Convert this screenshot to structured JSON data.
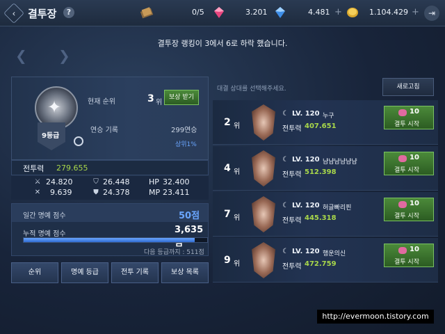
{
  "header": {
    "title": "결투장",
    "help": "?",
    "tickets": "0/5",
    "gem_red": "3.201",
    "gem_blue": "4.481",
    "gold": "1.104.429"
  },
  "notice": "결투장 랭킹이 3에서 6로 하락 했습니다.",
  "player": {
    "grade": "9등급",
    "current_rank_label": "현재 순위",
    "current_rank": "3",
    "rank_unit": "위",
    "reward_button": "보상 받기",
    "streak_label": "연승 기록",
    "streak": "299연승",
    "top_percent": "상위1%",
    "power_label": "전투력",
    "power": "279.655",
    "stats": {
      "atk": "24.820",
      "def": "26.448",
      "hp_label": "HP",
      "hp": "32.400",
      "acc": "9.639",
      "mdef": "24.378",
      "mp_label": "MP",
      "mp": "23.411"
    }
  },
  "honor": {
    "weekly_label": "일간 명예 점수",
    "weekly_value": "50점",
    "accumulated_label": "누적 명예 점수",
    "accumulated_value": "3,635점",
    "progress_percent": 93,
    "next_grade": "다음 등급까지 : 511점"
  },
  "bottom_buttons": [
    "순위",
    "명예 등급",
    "전투 기록",
    "보상 목록"
  ],
  "opponents_panel": {
    "hint": "대결 상대를 선택해주세요.",
    "refresh": "새로고침"
  },
  "opponents": [
    {
      "rank": "2",
      "level": "LV. 120",
      "name": "누구",
      "power": "407.651",
      "cost": "10",
      "action": "결투 시작"
    },
    {
      "rank": "4",
      "level": "LV. 120",
      "name": "냠냠냠냠냠냠",
      "power": "512.398",
      "cost": "10",
      "action": "결투 시작"
    },
    {
      "rank": "7",
      "level": "LV. 120",
      "name": "허글빠리핀",
      "power": "445.318",
      "cost": "10",
      "action": "결투 시작"
    },
    {
      "rank": "9",
      "level": "LV. 120",
      "name": "행운의신",
      "power": "472.759",
      "cost": "10",
      "action": "결투 시작"
    }
  ],
  "labels": {
    "rank_unit": "위",
    "power_label": "전투력"
  },
  "watermark": "http://evermoon.tistory.com",
  "colors": {
    "accent_green": "#4b8a3a",
    "power_green": "#a9d84a",
    "blue": "#6aa6ff"
  }
}
